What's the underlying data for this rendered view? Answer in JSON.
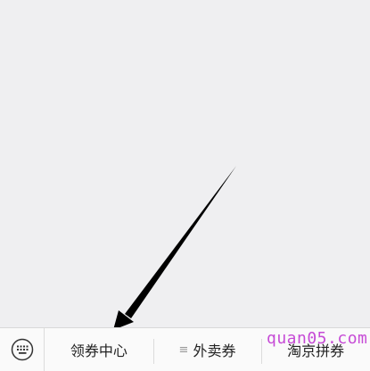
{
  "menu": {
    "items": [
      {
        "label": "领券中心"
      },
      {
        "label": "外卖券",
        "icon": "submenu-lines-icon",
        "icon_glyph": "≡"
      },
      {
        "label": "淘京拼券"
      }
    ],
    "keyboard_icon": "keyboard-icon"
  },
  "watermark": {
    "text": "quan05.com",
    "color": "#c64bd6"
  },
  "annotation": {
    "type": "arrow",
    "color": "#000000"
  }
}
